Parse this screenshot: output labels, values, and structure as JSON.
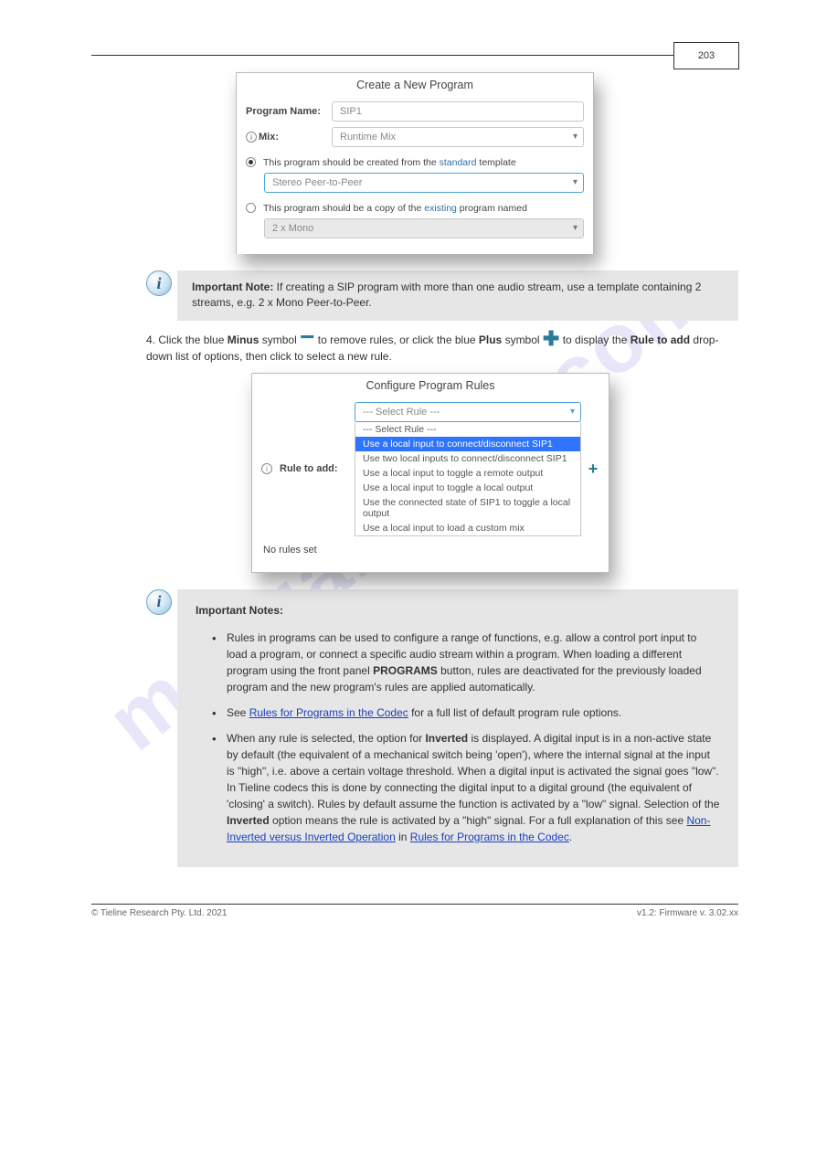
{
  "header": {
    "page_number": "203"
  },
  "dialog1": {
    "title": "Create a New Program",
    "program_name_label": "Program Name:",
    "program_name_value": "SIP1",
    "mix_label": "Mix:",
    "mix_value": "Runtime Mix",
    "radio_std_prefix": "This program should be created from the ",
    "radio_std_hl": "standard",
    "radio_std_suffix": " template",
    "std_select_value": "Stereo Peer-to-Peer",
    "radio_copy_prefix": "This program should be a copy of the ",
    "radio_copy_hl": "existing",
    "radio_copy_suffix": " program named",
    "copy_select_value": "2 x Mono"
  },
  "callout1": {
    "header": "Important Note:",
    "body": " If creating a SIP program with more than one audio stream, use a template containing 2 streams, e.g. 2 x Mono Peer-to-Peer."
  },
  "step4": {
    "num": "4.",
    "text_before_minus": "   Click the blue ",
    "minus_word": "Minus",
    "after_minus_1": " symbol ",
    "after_minus_2": " to remove rules, or click the blue ",
    "plus_word": "Plus",
    "after_plus_1": " symbol ",
    "after_plus_2": " to display the ",
    "rta": "Rule to add",
    "after_rta": " drop-down list of options, then click to select a new rule.",
    "minus_name": "minus-icon",
    "plus_name": "plus-icon"
  },
  "dialog2": {
    "title": "Configure Program Rules",
    "rule_label": "Rule to add:",
    "head": "--- Select Rule ---",
    "norules": "No rules set",
    "options": [
      "--- Select Rule ---",
      "Use a local input to connect/disconnect SIP1",
      "Use two local inputs to connect/disconnect SIP1",
      "Use a local input to toggle a remote output",
      "Use a local input to toggle a local output",
      "Use the connected state of SIP1 to toggle a local output",
      "Use a local input to load a custom mix"
    ],
    "selected_index": 1,
    "cursor_name": "cursor-icon"
  },
  "callout2": {
    "header": "Important Notes:",
    "bullets": [
      {
        "t1": "Rules in programs can be used to configure a range of functions, e.g. allow a control port input to load a program, or connect a specific audio stream within a program. When loading a different program using the front panel "
      },
      {
        "b": "PROGRAMS"
      },
      {
        "t2": " button, rules are deactivated for the previously loaded program and the new program's rules are applied automatically."
      },
      {
        "t3": "See "
      },
      {
        "link1": "Rules for Programs in the Codec"
      },
      {
        "t4": " for a full list of default program rule options."
      },
      {
        "t5": "When any rule is selected, the option for "
      },
      {
        "b2": "Inverted"
      },
      {
        "t6": " is displayed. A digital input is in a non-active state by default (the equivalent of a mechanical switch being 'open'), where the internal signal at the input is \"high\", i.e. above a certain voltage threshold. When a digital input is activated the signal goes \"low\". In Tieline codecs this is done by connecting the digital input to a digital ground (the equivalent of 'closing' a switch). Rules by default assume the function is activated by a \"low\" signal. Selection of the "
      },
      {
        "b3": "Inverted"
      },
      {
        "t7": " option means the rule is activated by a \"high\" signal. For a full explanation of this see "
      },
      {
        "link2": "Non-Inverted versus Inverted Operation"
      },
      {
        "t8": " in "
      },
      {
        "link3": "Rules for Programs in the Codec"
      },
      {
        "t9": "."
      }
    ]
  },
  "footer": {
    "left": "© Tieline Research Pty. Ltd. 2021",
    "right": "v1.2: Firmware v. 3.02.xx"
  },
  "watermark": "manualshive.com"
}
